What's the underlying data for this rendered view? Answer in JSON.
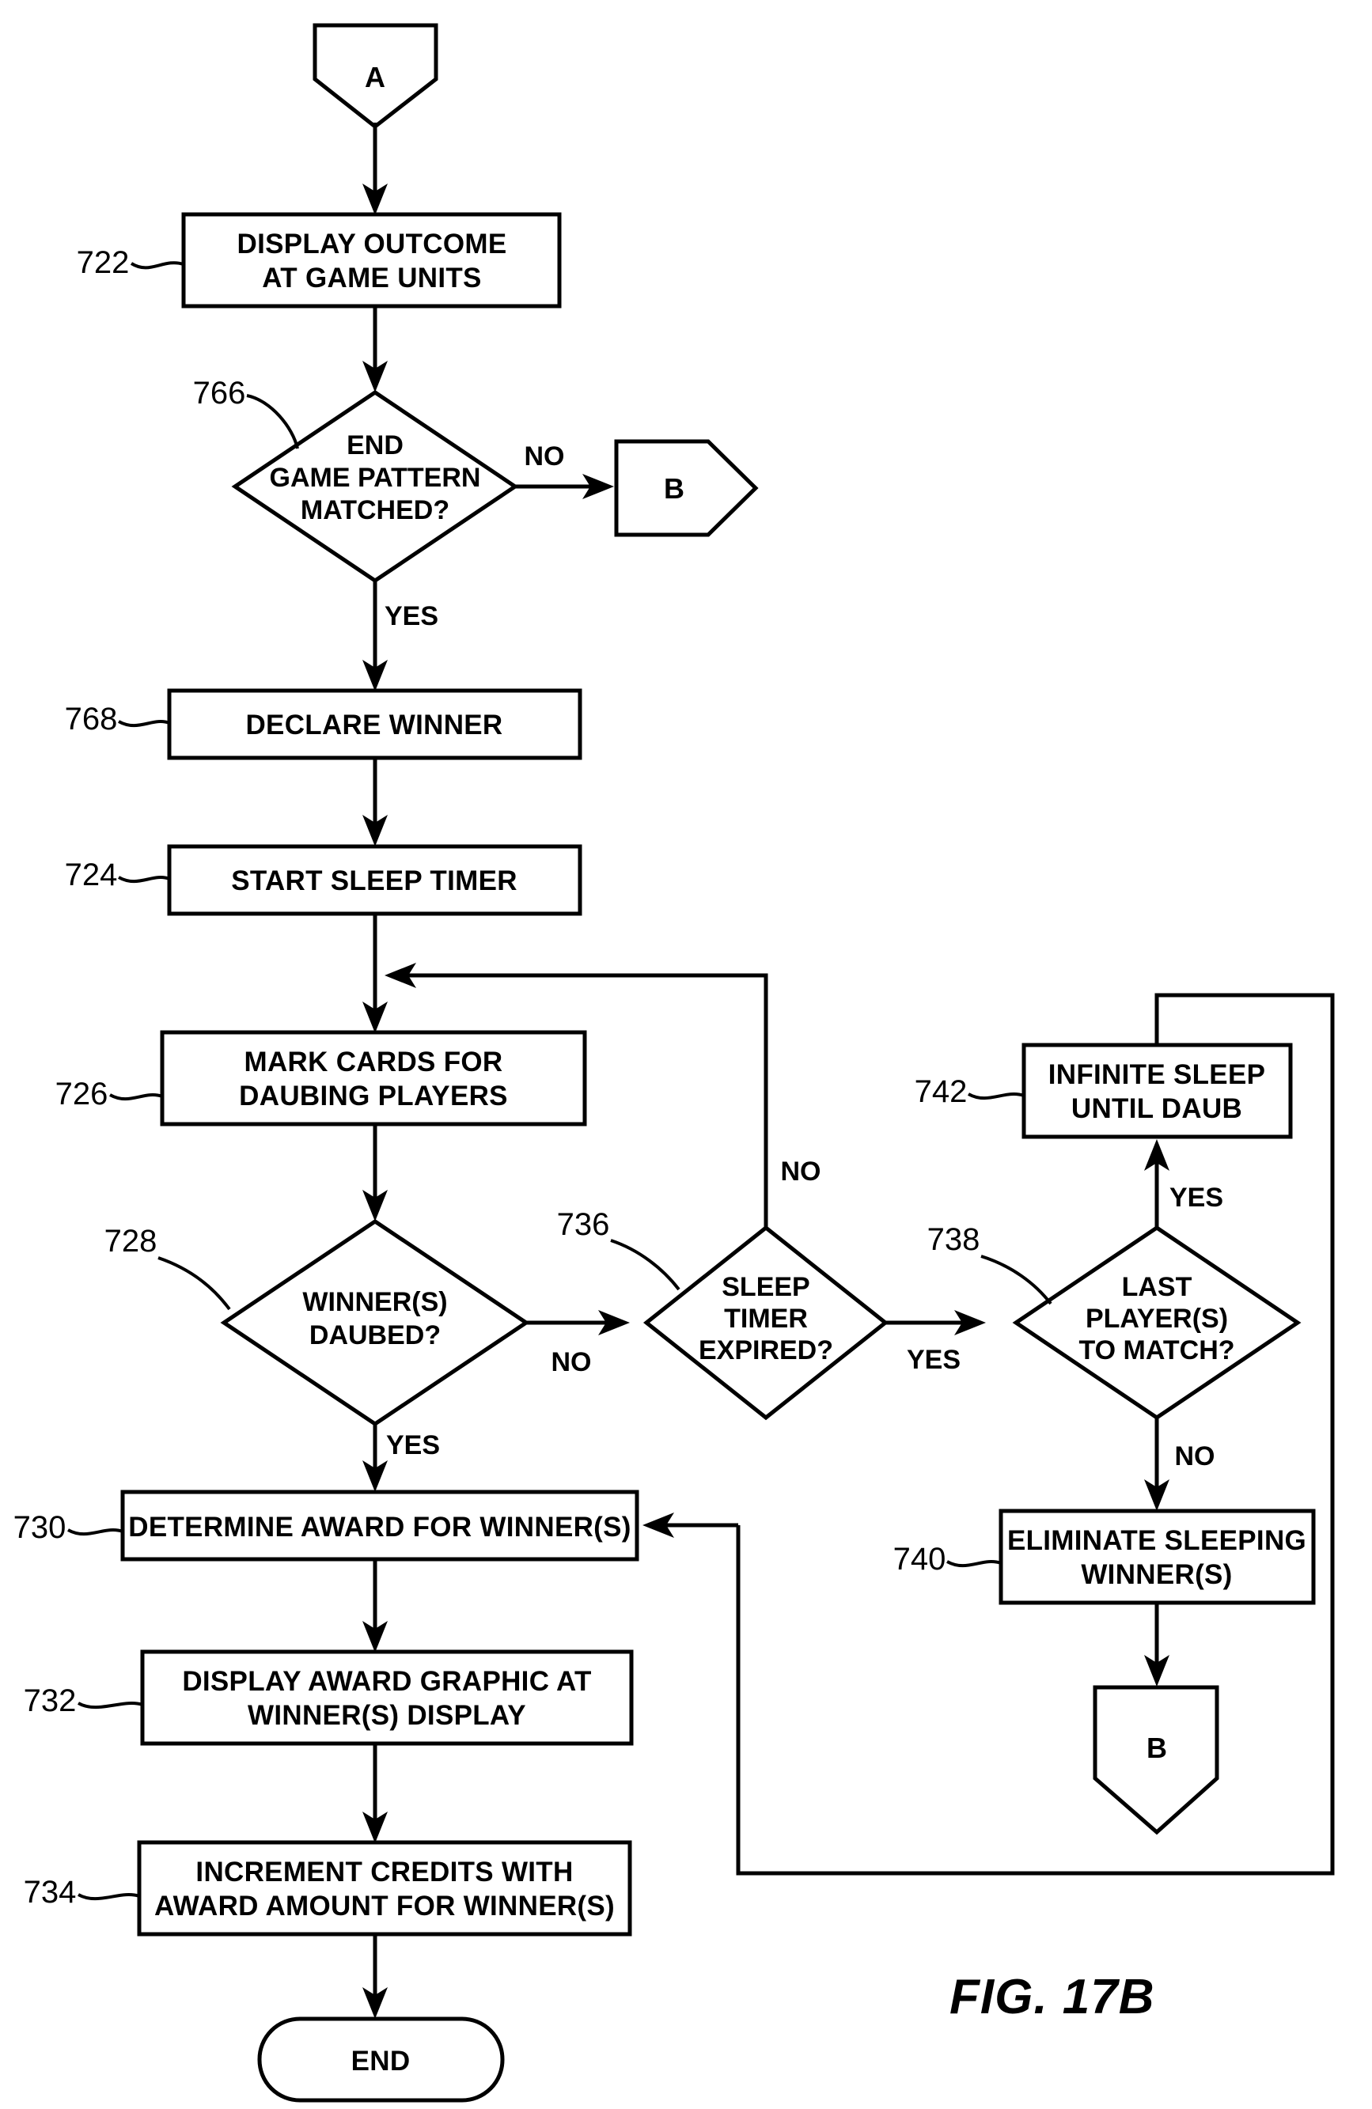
{
  "figure": {
    "caption": "FIG. 17B",
    "type": "patent-flowchart"
  },
  "nodes": {
    "entry_a": {
      "ref": "",
      "label": "A",
      "shape": "connector-down"
    },
    "n722": {
      "ref": "722",
      "line1": "DISPLAY OUTCOME",
      "line2": "AT GAME UNITS",
      "shape": "process"
    },
    "n766": {
      "ref": "766",
      "line1": "END",
      "line2": "GAME PATTERN",
      "line3": "MATCHED?",
      "shape": "decision"
    },
    "exit_b_top": {
      "ref": "",
      "label": "B",
      "shape": "connector-right"
    },
    "n768": {
      "ref": "768",
      "line1": "DECLARE WINNER",
      "shape": "process"
    },
    "n724": {
      "ref": "724",
      "line1": "START SLEEP TIMER",
      "shape": "process"
    },
    "n726": {
      "ref": "726",
      "line1": "MARK CARDS FOR",
      "line2": "DAUBING PLAYERS",
      "shape": "process"
    },
    "n728": {
      "ref": "728",
      "line1": "WINNER(S)",
      "line2": "DAUBED?",
      "shape": "decision"
    },
    "n736": {
      "ref": "736",
      "line1": "SLEEP",
      "line2": "TIMER",
      "line3": "EXPIRED?",
      "shape": "decision"
    },
    "n738": {
      "ref": "738",
      "line1": "LAST",
      "line2": "PLAYER(S)",
      "line3": "TO MATCH?",
      "shape": "decision"
    },
    "n742": {
      "ref": "742",
      "line1": "INFINITE SLEEP",
      "line2": "UNTIL DAUB",
      "shape": "process"
    },
    "n740": {
      "ref": "740",
      "line1": "ELIMINATE SLEEPING",
      "line2": "WINNER(S)",
      "shape": "process"
    },
    "exit_b_bottom": {
      "ref": "",
      "label": "B",
      "shape": "connector-down"
    },
    "n730": {
      "ref": "730",
      "line1": "DETERMINE AWARD FOR WINNER(S)",
      "shape": "process"
    },
    "n732": {
      "ref": "732",
      "line1": "DISPLAY AWARD GRAPHIC AT",
      "line2": "WINNER(S) DISPLAY",
      "shape": "process"
    },
    "n734": {
      "ref": "734",
      "line1": "INCREMENT CREDITS WITH",
      "line2": "AWARD AMOUNT FOR WINNER(S)",
      "shape": "process"
    },
    "end": {
      "ref": "",
      "label": "END",
      "shape": "terminator"
    }
  },
  "edge_labels": {
    "e766_no": "NO",
    "e766_yes": "YES",
    "e728_no": "NO",
    "e728_yes": "YES",
    "e736_no": "NO",
    "e736_yes": "YES",
    "e738_yes": "YES",
    "e738_no": "NO"
  },
  "colors": {
    "stroke": "#000000",
    "fill": "#ffffff",
    "background": "#ffffff"
  }
}
